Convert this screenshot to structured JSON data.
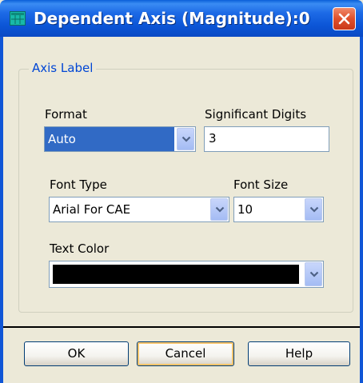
{
  "window": {
    "title": "Dependent Axis (Magnitude):0"
  },
  "group": {
    "legend": "Axis Label"
  },
  "format": {
    "label": "Format",
    "value": "Auto"
  },
  "significant_digits": {
    "label": "Significant Digits",
    "value": "3"
  },
  "font_type": {
    "label": "Font Type",
    "value": "Arial For CAE"
  },
  "font_size": {
    "label": "Font Size",
    "value": "10"
  },
  "text_color": {
    "label": "Text Color",
    "value": "#000000"
  },
  "buttons": {
    "ok": "OK",
    "cancel": "Cancel",
    "help": "Help"
  },
  "colors": {
    "titlebar": "#0b55d6",
    "legend_text": "#0046d5",
    "selection": "#316ac5",
    "close_button": "#e0502b"
  }
}
